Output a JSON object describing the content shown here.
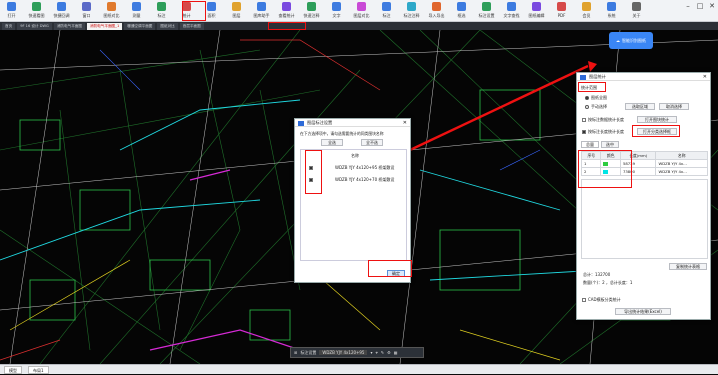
{
  "ribbon": {
    "buttons": [
      {
        "label": "打开",
        "color": "#3d7be0"
      },
      {
        "label": "快速看图",
        "color": "#2e9e5a"
      },
      {
        "label": "快捷回调",
        "color": "#3d7be0"
      },
      {
        "label": "窗口",
        "color": "#5b6ac8"
      },
      {
        "label": "图纸对比",
        "color": "#e07a2e"
      },
      {
        "label": "测量",
        "color": "#3d7be0"
      },
      {
        "label": "标注",
        "color": "#2e9e5a"
      },
      {
        "label": "统计",
        "color": "#d64a4a"
      },
      {
        "label": "面积",
        "color": "#3d7be0"
      },
      {
        "label": "图层",
        "color": "#e0a22e"
      },
      {
        "label": "图库助手",
        "color": "#3d7be0"
      },
      {
        "label": "查看统计",
        "color": "#7a4ae0"
      },
      {
        "label": "快速注释",
        "color": "#2e9e5a"
      },
      {
        "label": "文字",
        "color": "#3d7be0"
      },
      {
        "label": "图层对比",
        "color": "#c94ad6"
      },
      {
        "label": "标注",
        "color": "#3d7be0"
      },
      {
        "label": "标注注释",
        "color": "#2ea8c9"
      },
      {
        "label": "导入导出",
        "color": "#e0662e"
      },
      {
        "label": "框选",
        "color": "#3d7be0"
      },
      {
        "label": "标注设置",
        "color": "#2e9e5a"
      },
      {
        "label": "文字查找",
        "color": "#3d7be0"
      },
      {
        "label": "图纸编辑",
        "color": "#7a4ae0"
      },
      {
        "label": "PDF",
        "color": "#d64a4a"
      },
      {
        "label": "会员",
        "color": "#e0a22e"
      },
      {
        "label": "系统",
        "color": "#3d7be0"
      },
      {
        "label": "关于",
        "color": "#666666"
      }
    ],
    "highlighted_index": 10
  },
  "window_controls": {
    "minimize": "–",
    "maximize": "□",
    "close": "✕"
  },
  "tabs": [
    {
      "label": "首页"
    },
    {
      "label": "9F 16 设计 DWG"
    },
    {
      "label": "消防电气平面图"
    },
    {
      "label": "消防电气平面图_1",
      "active": true
    },
    {
      "label": "暖通空调平面图"
    },
    {
      "label": "图纸对比"
    },
    {
      "label": "首层平面图"
    }
  ],
  "cloud_button": {
    "label": "智能识别图纸"
  },
  "dialog_select": {
    "title": "图层标注设置",
    "instruction": "在下方选择项中，请勾选需要统计的同类图块名称",
    "btn_select_all": "全选",
    "btn_select_none": "全不选",
    "col_name": "名称",
    "items": [
      {
        "name": "WDZB YJY 4x120+95 桥架敷设",
        "checked": true
      },
      {
        "name": "WDZB YJY 4x120+70 桥架敷设",
        "checked": true
      }
    ],
    "ok_label": "确定"
  },
  "dialog_stats": {
    "title": "图层统计",
    "section_label": "统计范围",
    "scope_options": [
      {
        "label": "图纸全图",
        "selected": true
      },
      {
        "label": "手动选择",
        "selected": false
      }
    ],
    "scope_buttons": [
      "选取区域",
      "取消选择"
    ],
    "options": [
      {
        "label": "按标注数据统计长度",
        "checked": false,
        "button": "打开图块统计"
      },
      {
        "label": "按标注长度统计长度",
        "checked": true,
        "button": "打开分类选择框"
      }
    ],
    "result_tabs": [
      "总量",
      "选中"
    ],
    "table_headers": [
      "序号",
      "颜色",
      "长度(mm)",
      "名称"
    ],
    "rows": [
      {
        "index": "1",
        "color": "#2ecc40",
        "length": "58739",
        "name": "WDZB YJY 4x..."
      },
      {
        "index": "2",
        "color": "#00e5e5",
        "length": "73800",
        "name": "WDZB YJY 4x..."
      }
    ],
    "export_label": "复制统计表格",
    "summary_lines": [
      "总计：132700",
      "数量(个)：2 ，总计长度：1"
    ],
    "bottom_check": "CAD模板分类统计",
    "bottom_button": "导出统计结果(Excel)"
  },
  "bottom_toolbar": {
    "label": "标注设置",
    "value": "WDZB YJY 4x120+95"
  },
  "status_tabs": [
    "模型",
    "布局1"
  ]
}
